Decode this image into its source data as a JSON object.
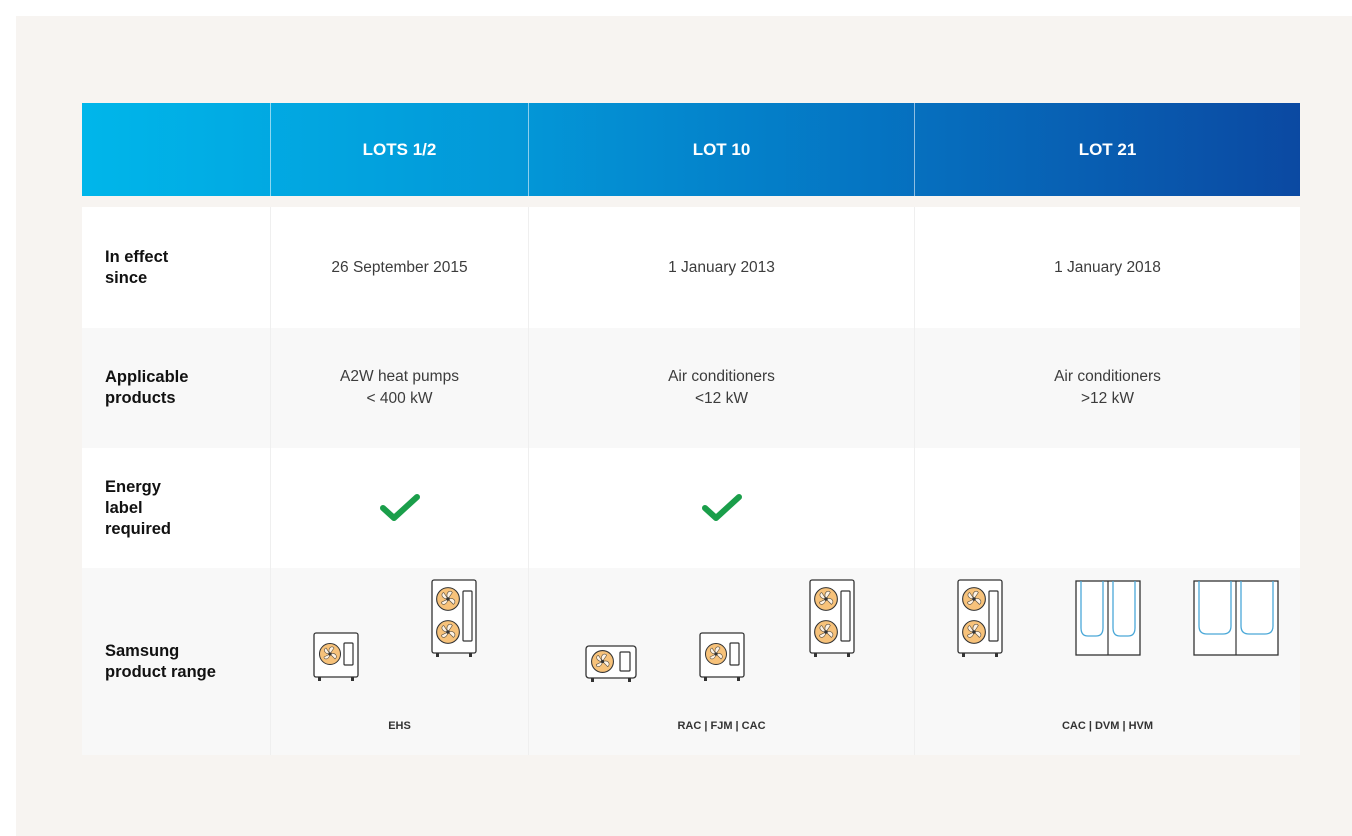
{
  "header": {
    "col1": "LOTS 1/2",
    "col2": "LOT 10",
    "col3": "LOT 21"
  },
  "rows": {
    "in_effect": {
      "label_line1": "In effect",
      "label_line2": "since",
      "col1": "26 September 2015",
      "col2": "1 January 2013",
      "col3": "1 January 2018"
    },
    "applicable": {
      "label_line1": "Applicable",
      "label_line2": "products",
      "col1_line1": "A2W heat pumps",
      "col1_line2": "< 400 kW",
      "col2_line1": "Air conditioners",
      "col2_line2": "<12 kW",
      "col3_line1": "Air conditioners",
      "col3_line2": ">12 kW"
    },
    "energy_label": {
      "label_line1": "Energy",
      "label_line2": "label",
      "label_line3": "required",
      "col1_check": true,
      "col2_check": true,
      "col3_check": false,
      "check_color": "#1a9e4a",
      "check_icon": "checkmark-icon"
    },
    "range": {
      "label_line1": "Samsung",
      "label_line2": "product range",
      "col1_caption": "EHS",
      "col2_caption": "RAC | FJM | CAC",
      "col3_caption": "CAC | DVM | HVM",
      "fan_color": "#f7c27a",
      "outline_color": "#333333",
      "accent_color": "#4aa8d8"
    }
  },
  "colors": {
    "header_start": "#00b6ea",
    "header_end": "#0b49a2",
    "panel_bg": "#f7f4f1"
  }
}
